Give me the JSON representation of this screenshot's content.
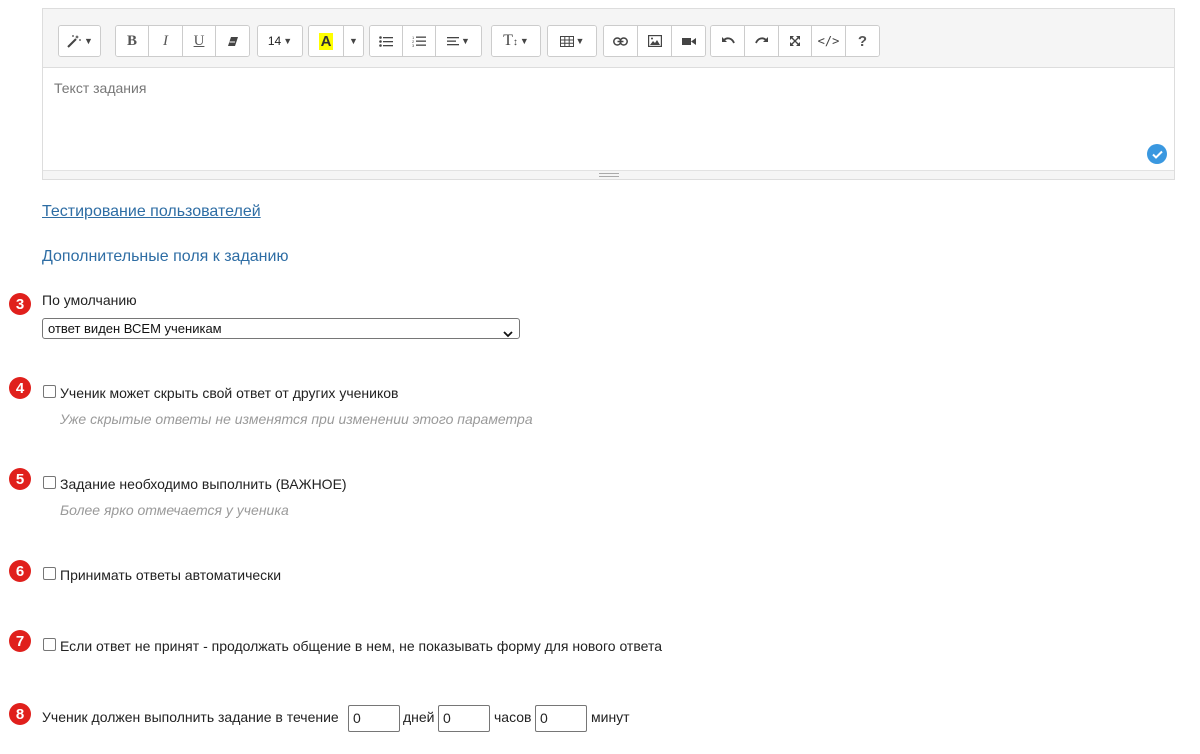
{
  "editor": {
    "placeholder": "Текст задания",
    "toolbar": {
      "font_size": "14",
      "highlight_color": "#ffff00",
      "highlight_label": "A",
      "bold": "B",
      "italic": "I",
      "underline": "U",
      "text_height": "T",
      "help": "?"
    }
  },
  "links": {
    "user_testing": "Тестирование пользователей",
    "extra_fields": "Дополнительные поля к заданию"
  },
  "options": {
    "visibility": {
      "badge": "3",
      "label": "По умолчанию",
      "selected": "ответ виден ВСЕМ ученикам"
    },
    "hide_answer": {
      "badge": "4",
      "label": "Ученик может скрыть свой ответ от других учеников",
      "hint": "Уже скрытые ответы не изменятся при изменении этого параметра",
      "checked": false
    },
    "important": {
      "badge": "5",
      "label": "Задание необходимо выполнить (ВАЖНОЕ)",
      "hint": "Более ярко отмечается у ученика",
      "checked": false
    },
    "auto_accept": {
      "badge": "6",
      "label": "Принимать ответы автоматически",
      "checked": false
    },
    "continue_chat": {
      "badge": "7",
      "label": "Если ответ не принят - продолжать общение в нем, не показывать форму для нового ответа",
      "checked": false
    },
    "deadline": {
      "badge": "8",
      "label": "Ученик должен выполнить задание в течение",
      "days_value": "0",
      "days_label": "дней",
      "hours_value": "0",
      "hours_label": "часов",
      "minutes_value": "0",
      "minutes_label": "минут"
    }
  },
  "colors": {
    "badge": "#e0201c",
    "link": "#2e6da4",
    "check_badge": "#3a98e0"
  }
}
